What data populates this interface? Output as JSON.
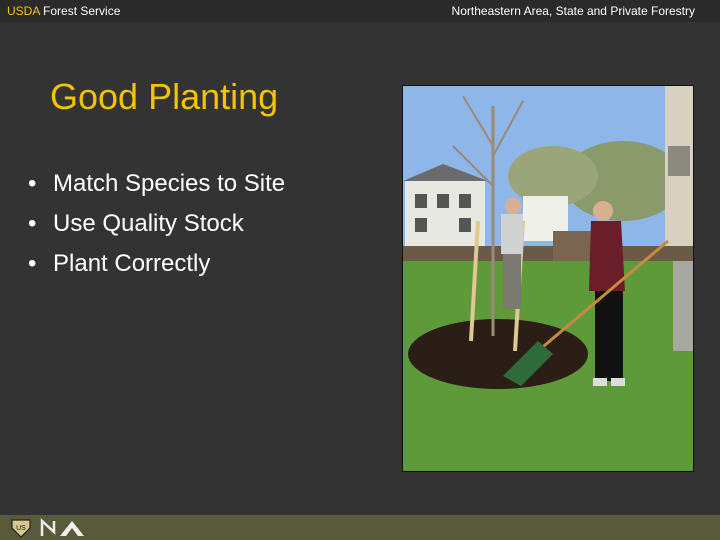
{
  "header": {
    "org_prefix": "USDA",
    "org_name": " Forest Service",
    "division": "Northeastern Area, State and Private Forestry"
  },
  "slide": {
    "title": "Good Planting",
    "bullets": [
      "Match Species to Site",
      "Use Quality Stock",
      "Plant Correctly"
    ],
    "bullet_glyph": "•"
  },
  "photo": {
    "description_icon": "tree-planting-photo"
  },
  "footer": {
    "logos": [
      "forest-service-shield-icon",
      "northeastern-area-logo-icon"
    ]
  },
  "colors": {
    "background": "#333333",
    "title": "#f4c300",
    "footer_band": "#595a3a"
  }
}
